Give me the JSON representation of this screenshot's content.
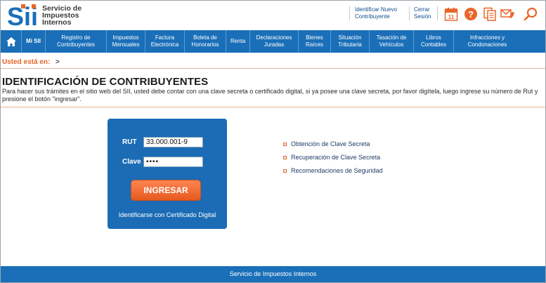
{
  "header": {
    "logo_text": "Sii",
    "org_lines": [
      "Servicio de",
      "Impuestos",
      "Internos"
    ],
    "links": [
      {
        "lines": [
          "Identificar Nuevo",
          "Contribuyente"
        ]
      },
      {
        "lines": [
          "Cerrar",
          "Sesión"
        ]
      }
    ],
    "icons": [
      "calendar-icon",
      "help-icon",
      "documents-icon",
      "contact-icon",
      "search-icon"
    ],
    "calendar_day": "11",
    "accent_color": "#e8662b"
  },
  "nav": {
    "home_icon": "home-icon",
    "mi_sii": "Mi SII",
    "items": [
      {
        "lines": [
          "Registro de",
          "Contribuyentes"
        ]
      },
      {
        "lines": [
          "Impuestos",
          "Mensuales"
        ]
      },
      {
        "lines": [
          "Factura",
          "Electrónica"
        ]
      },
      {
        "lines": [
          "Boleta de",
          "Honorarios"
        ]
      },
      {
        "lines": [
          "Renta"
        ]
      },
      {
        "lines": [
          "Declaraciones",
          "Juradas"
        ]
      },
      {
        "lines": [
          "Bienes",
          "Raíces"
        ]
      },
      {
        "lines": [
          "Situación",
          "Tributaria"
        ]
      },
      {
        "lines": [
          "Tasación de",
          "Vehículos"
        ]
      },
      {
        "lines": [
          "Libros",
          "Contables"
        ]
      },
      {
        "lines": [
          "Infracciones y",
          "Condonaciones"
        ]
      }
    ],
    "color": "#1a6fb8"
  },
  "breadcrumb": {
    "label": "Usted está en:",
    "arrow": ">"
  },
  "page": {
    "title": "IDENTIFICACIÓN DE CONTRIBUYENTES",
    "intro": "Para hacer sus trámites en el sitio web del SII, usted debe contar con una clave secreta o certificado digital, si ya posee una clave secreta, por favor digítela, luego ingrese su número de Rut y presione el botón \"ingresar\"."
  },
  "login": {
    "rut_label": "RUT",
    "rut_value": "33.000.001-9",
    "clave_label": "Clave",
    "clave_value": "••••",
    "submit_label": "INGRESAR",
    "cert_link": "Identificarse con Certificado Digital"
  },
  "side_links": [
    "Obtención de Clave Secreta",
    "Recuperación de Clave Secreta",
    "Recomendaciones de Seguridad"
  ],
  "footer": {
    "text": "Servicio de Impuestos Internos"
  }
}
